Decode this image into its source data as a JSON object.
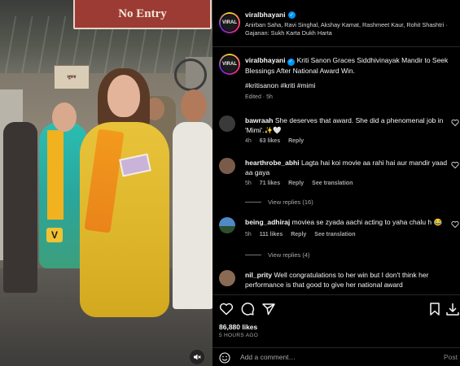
{
  "media": {
    "sign_text": "No Entry",
    "notice_text": "सूचना",
    "brand_mark": "V"
  },
  "header": {
    "username": "viralbhayani",
    "avatar_text": "VIRAL",
    "audio_line": "Anirban Saha, Ravi Singhal, Akshay Kamat, Rashmeet Kaur, Rohit Shashtri · Gajanan: Sukh Karta Dukh Harta"
  },
  "caption": {
    "username": "viralbhayani",
    "avatar_text": "VIRAL",
    "text": "Kriti Sanon Graces Siddhivinayak Mandir to Seek Blessings After National Award Win.",
    "hashtags": "#kritisanon #kriti #mimi",
    "meta": "Edited · 5h"
  },
  "comments": [
    {
      "username": "bawraah",
      "text": "She deserves that award. She did a phenomenal job in 'Mimi'.✨🤍",
      "time": "4h",
      "likes": "63 likes",
      "reply": "Reply",
      "translation": "",
      "view_replies": "",
      "avatar_color": "#3a3a3a"
    },
    {
      "username": "hearthrobe_abhi",
      "text": "Lagta hai koi movie aa rahi hai aur mandir yaad aa gaya",
      "time": "5h",
      "likes": "71 likes",
      "reply": "Reply",
      "translation": "See translation",
      "view_replies": "View replies (16)",
      "avatar_color": "#7a5b4a"
    },
    {
      "username": "being_adhiraj",
      "text": "moviea se zyada aachi acting to yaha chalu h 😂",
      "time": "5h",
      "likes": "111 likes",
      "reply": "Reply",
      "translation": "See translation",
      "view_replies": "View replies (4)",
      "avatar_color": "#3b6fa8"
    },
    {
      "username": "nil_prity",
      "text": "Well congratulations to her win but I don't think her performance is that good to give her national award",
      "time": "",
      "likes": "",
      "reply": "",
      "translation": "",
      "view_replies": "",
      "avatar_color": "#8a6a55"
    }
  ],
  "actions": {
    "likes": "86,880 likes",
    "time_ago": "5 HOURS AGO",
    "add_comment_placeholder": "Add a comment…",
    "post_label": "Post"
  },
  "colors": {
    "verified": "#0095f6",
    "muted_text": "#a8a8a8"
  }
}
